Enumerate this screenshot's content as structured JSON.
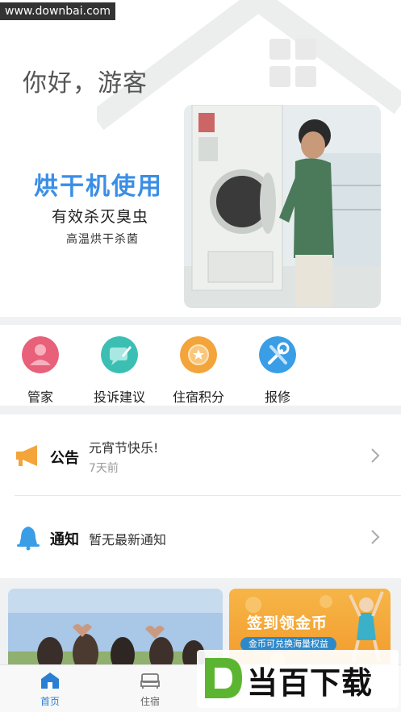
{
  "watermark": "www.downbai.com",
  "header": {
    "greeting": "你好，游客"
  },
  "banner": {
    "title": "烘干机使用",
    "subtitle": "有效杀灭臭虫",
    "subtitle2": "高温烘干杀菌"
  },
  "menu": {
    "items": [
      {
        "label": "管家",
        "icon": "butler-icon",
        "color": "#e8607a"
      },
      {
        "label": "投诉建议",
        "icon": "feedback-icon",
        "color": "#3bbfb3"
      },
      {
        "label": "住宿积分",
        "icon": "points-icon",
        "color": "#f3a43a"
      },
      {
        "label": "报修",
        "icon": "repair-icon",
        "color": "#3a9ee6"
      }
    ]
  },
  "notices": {
    "announcement": {
      "kind": "公告",
      "text": "元宵节快乐!",
      "time": "7天前"
    },
    "notification": {
      "kind": "通知",
      "text": "暂无最新通知"
    }
  },
  "promos": {
    "right_title": "签到领金币",
    "right_sub": "金币可兑换海量权益"
  },
  "tabbar": {
    "items": [
      {
        "label": "首页",
        "active": true
      },
      {
        "label": "住宿",
        "active": false
      }
    ]
  },
  "corner_logo": {
    "text": "当百下载"
  },
  "colors": {
    "accent": "#2a7fd3",
    "banner_title": "#3a8ee6",
    "promo_orange": "#f39a2a"
  }
}
